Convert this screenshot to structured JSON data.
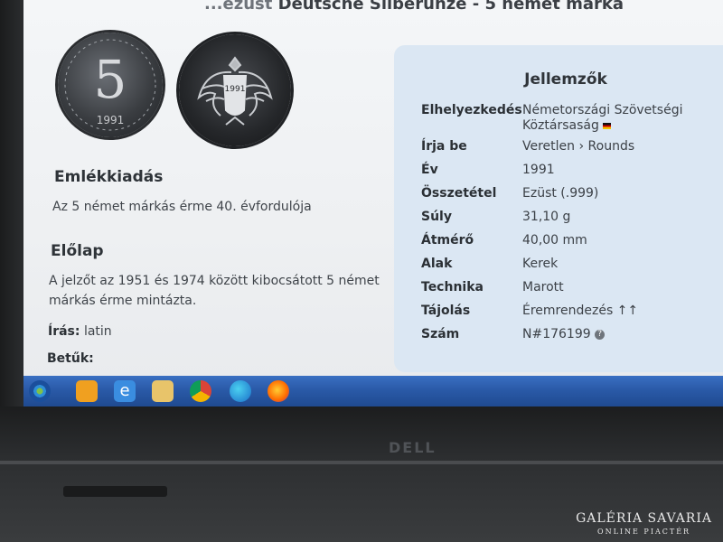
{
  "page": {
    "title_main": "...ezüst",
    "title_sub": "Deutsche Silberunze - 5 német márka"
  },
  "coin": {
    "obverse_value": "5",
    "obverse_year": "1991",
    "reverse_year": "1991"
  },
  "left": {
    "section1_heading": "Emlékkiadás",
    "section1_text": "Az 5 német márkás érme 40. évfordulója",
    "section2_heading": "Előlap",
    "section2_text_line1": "A jelzőt az 1951 és 1974 között kibocsátott 5 német",
    "section2_text_line2": "márkás érme mintázta.",
    "script_label": "Írás:",
    "script_value": "latin",
    "letters_label": "Betűk:"
  },
  "card": {
    "title": "Jellemzők",
    "rows": [
      {
        "key": "Elhelyezkedés",
        "value": "Németországi Szövetségi Köztársaság"
      },
      {
        "key": "Írja be",
        "value": "Veretlen › Rounds"
      },
      {
        "key": "Év",
        "value": "1991"
      },
      {
        "key": "Összetétel",
        "value": "Ezüst (.999)"
      },
      {
        "key": "Súly",
        "value": "31,10 g"
      },
      {
        "key": "Átmérő",
        "value": "40,00 mm"
      },
      {
        "key": "Alak",
        "value": "Kerek"
      },
      {
        "key": "Technika",
        "value": "Marott"
      },
      {
        "key": "Tájolás",
        "value": "Éremrendezés ↑↑"
      },
      {
        "key": "Szám",
        "value": "N#176199"
      }
    ],
    "link_color": "#2c6fd6"
  },
  "taskbar": {
    "icons": [
      "start-orb-icon",
      "media-player-icon",
      "internet-explorer-icon",
      "file-explorer-icon",
      "chrome-icon",
      "edge-icon",
      "firefox-icon"
    ]
  },
  "watermark": {
    "line1": "GALÉRIA SAVARIA",
    "line2": "ONLINE PIACTÉR"
  }
}
